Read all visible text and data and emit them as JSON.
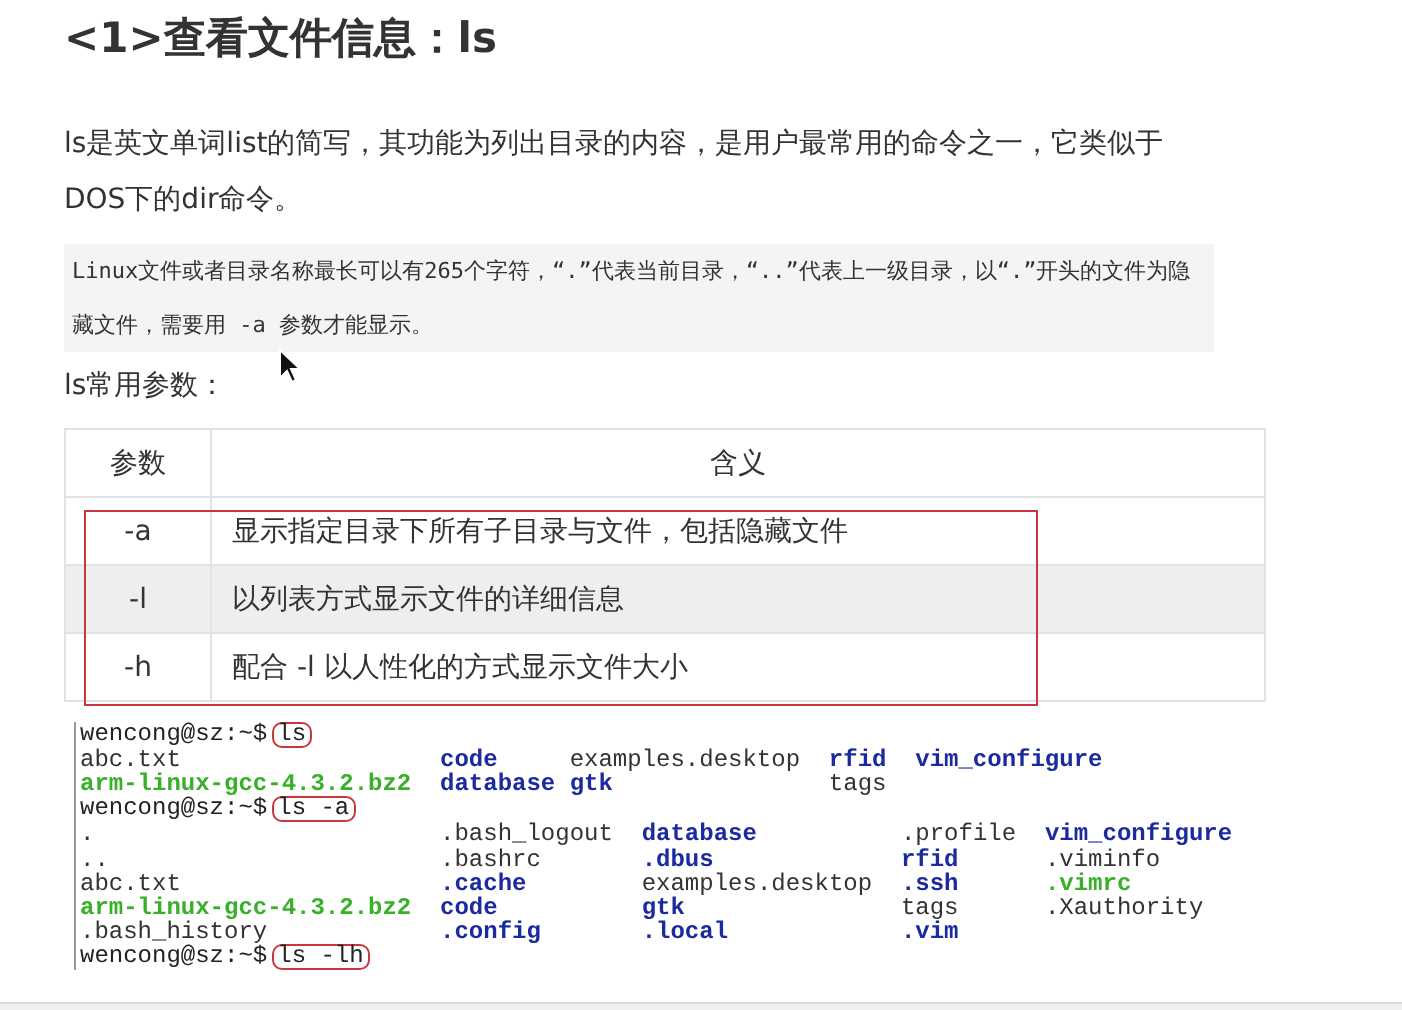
{
  "title": "<1>查看文件信息：ls",
  "intro": "ls是英文单词list的简写，其功能为列出目录的内容，是用户最常用的命令之一，它类似于DOS下的dir命令。",
  "note": "Linux文件或者目录名称最长可以有265个字符，“.”代表当前目录，“..”代表上一级目录，以“.”开头的文件为隐藏文件，需要用 -a 参数才能显示。",
  "params_label": "ls常用参数：",
  "table": {
    "columns": [
      "参数",
      "含义"
    ],
    "rows": [
      {
        "cells": [
          "-a",
          "显示指定目录下所有子目录与文件，包括隐藏文件"
        ],
        "shaded": false
      },
      {
        "cells": [
          "-l",
          "以列表方式显示文件的详细信息"
        ],
        "shaded": true
      },
      {
        "cells": [
          "-h",
          "配合 -l 以人性化的方式显示文件大小"
        ],
        "shaded": false
      }
    ]
  },
  "terminal": {
    "blocks": [
      {
        "prompt": "wencong@sz:~$",
        "command": "ls",
        "lines": [
          [
            {
              "text": "abc.txt",
              "kind": "file"
            },
            {
              "text": "code",
              "kind": "dir"
            },
            {
              "text": "examples.desktop",
              "kind": "file"
            },
            {
              "text": "rfid",
              "kind": "dir"
            },
            {
              "text": "vim_configure",
              "kind": "dir"
            }
          ],
          [
            {
              "text": "arm-linux-gcc-4.3.2.bz2",
              "kind": "exec"
            },
            {
              "text": "database",
              "kind": "dir"
            },
            {
              "text": "gtk",
              "kind": "dir"
            },
            {
              "text": "tags",
              "kind": "file"
            }
          ]
        ]
      },
      {
        "prompt": "wencong@sz:~$",
        "command": "ls -a",
        "lines": [
          [
            {
              "text": ".",
              "kind": "file"
            },
            {
              "text": ".bash_logout",
              "kind": "file"
            },
            {
              "text": "database",
              "kind": "dir"
            },
            {
              "text": ".profile",
              "kind": "file"
            },
            {
              "text": "vim_configure",
              "kind": "dir"
            }
          ],
          [
            {
              "text": "..",
              "kind": "file"
            },
            {
              "text": ".bashrc",
              "kind": "file"
            },
            {
              "text": ".dbus",
              "kind": "dir"
            },
            {
              "text": "rfid",
              "kind": "dir"
            },
            {
              "text": ".viminfo",
              "kind": "file"
            }
          ],
          [
            {
              "text": "abc.txt",
              "kind": "file"
            },
            {
              "text": ".cache",
              "kind": "dir"
            },
            {
              "text": "examples.desktop",
              "kind": "file"
            },
            {
              "text": ".ssh",
              "kind": "dir"
            },
            {
              "text": ".vimrc",
              "kind": "exec"
            }
          ],
          [
            {
              "text": "arm-linux-gcc-4.3.2.bz2",
              "kind": "exec"
            },
            {
              "text": "code",
              "kind": "dir"
            },
            {
              "text": "gtk",
              "kind": "dir"
            },
            {
              "text": "tags",
              "kind": "file"
            },
            {
              "text": ".Xauthority",
              "kind": "file"
            }
          ],
          [
            {
              "text": ".bash_history",
              "kind": "file"
            },
            {
              "text": ".config",
              "kind": "dir"
            },
            {
              "text": ".local",
              "kind": "dir"
            },
            {
              "text": ".vim",
              "kind": "dir"
            }
          ]
        ]
      },
      {
        "prompt": "wencong@sz:~$",
        "command": "ls -lh"
      }
    ]
  }
}
